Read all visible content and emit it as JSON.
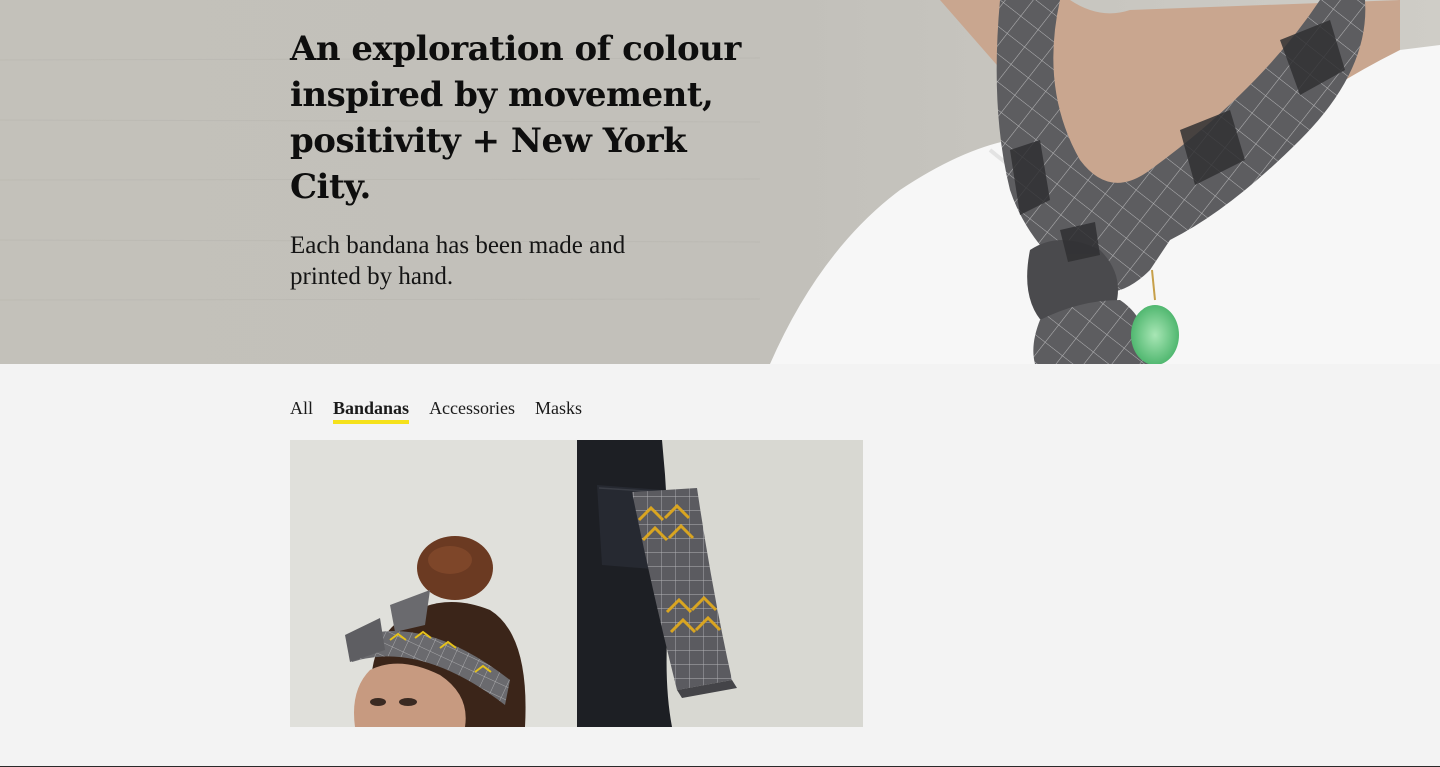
{
  "hero": {
    "title": "An exploration of colour inspired by movement, positivity + New York City.",
    "subtitle": "Each bandana has been made and printed by hand.",
    "image": "man-wearing-grey-bandana-photo"
  },
  "filters": {
    "tabs": [
      {
        "label": "All",
        "active": false
      },
      {
        "label": "Bandanas",
        "active": true
      },
      {
        "label": "Accessories",
        "active": false
      },
      {
        "label": "Masks",
        "active": false
      }
    ],
    "active_underline_color": "#f5e11b"
  },
  "products": [
    {
      "image": "woman-with-bandana-headband-photo"
    },
    {
      "image": "bandana-in-jeans-pocket-photo"
    }
  ],
  "colors": {
    "page_background": "#f3f3f3",
    "text": "#111111",
    "accent_yellow": "#f5e11b"
  }
}
